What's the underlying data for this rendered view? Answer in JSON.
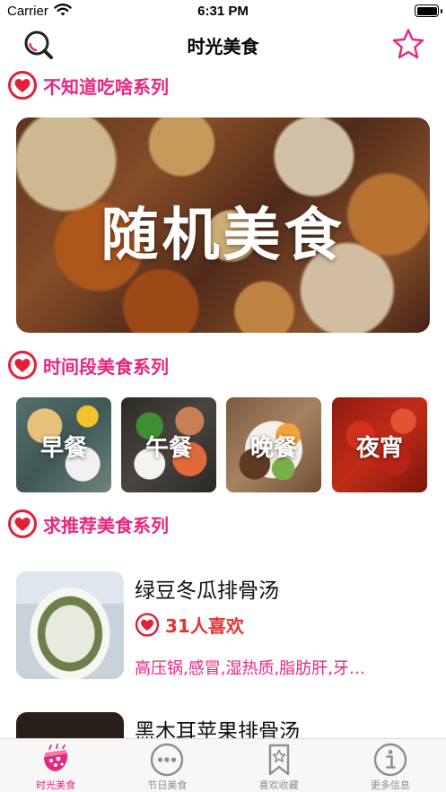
{
  "status_bar": {
    "carrier": "Carrier",
    "time": "6:31 PM"
  },
  "nav": {
    "title": "时光美食",
    "search_icon": "search-icon",
    "favorite_icon": "star-icon"
  },
  "colors": {
    "accent": "#e8267f",
    "likes": "#e63232",
    "heart": "#e3203a"
  },
  "sections": {
    "random": {
      "label": "不知道吃啥系列",
      "banner_text": "随机美食"
    },
    "meal_time": {
      "label": "时间段美食系列",
      "meals": [
        {
          "label": "早餐"
        },
        {
          "label": "午餐"
        },
        {
          "label": "晚餐"
        },
        {
          "label": "夜宵"
        }
      ]
    },
    "recommend": {
      "label": "求推荐美食系列",
      "items": [
        {
          "title": "绿豆冬瓜排骨汤",
          "likes": "31人喜欢",
          "tags": "高压锅,感冒,湿热质,脂肪肝,牙…"
        },
        {
          "title": "黑木耳苹果排骨汤"
        }
      ]
    }
  },
  "tabbar": {
    "tabs": [
      {
        "label": "时光美食",
        "icon": "food-icon",
        "active": true
      },
      {
        "label": "节日美食",
        "icon": "more-dots-icon",
        "active": false
      },
      {
        "label": "喜欢收藏",
        "icon": "bookmark-star-icon",
        "active": false
      },
      {
        "label": "更多信息",
        "icon": "info-icon",
        "active": false
      }
    ]
  }
}
